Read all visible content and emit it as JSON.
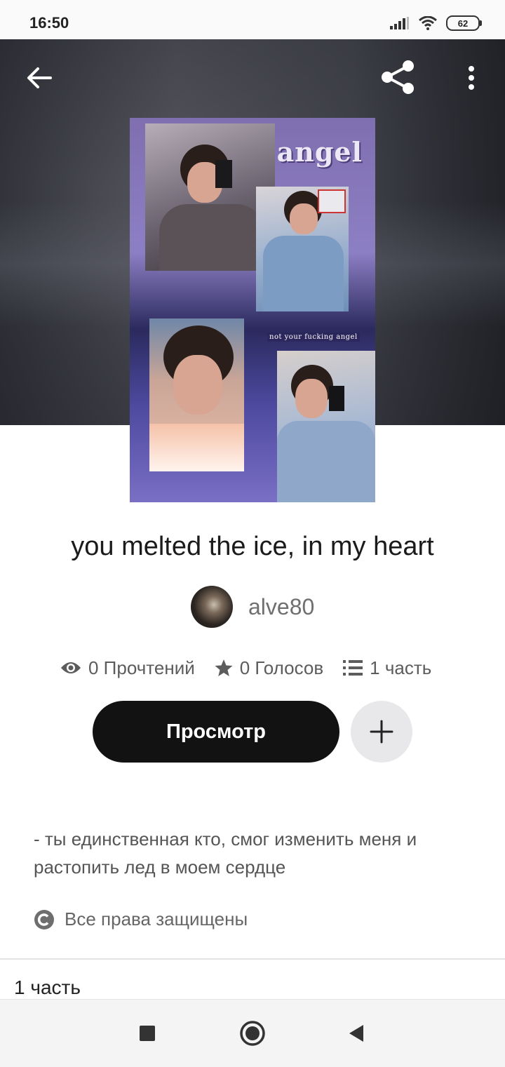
{
  "status_bar": {
    "time": "16:50",
    "battery": "62"
  },
  "header": {
    "back_icon": "arrow-left-icon",
    "share_icon": "share-icon",
    "more_icon": "more-vertical-icon"
  },
  "cover": {
    "cover_text": "angel",
    "cover_caption": "not your fucking angel"
  },
  "story": {
    "title": "you melted the ice, in my heart",
    "author": "alve80",
    "reads": "0 Прочтений",
    "votes": "0 Голосов",
    "parts": "1 часть",
    "read_button": "Просмотр",
    "description": "- ты единственная кто, смог изменить меня и растопить лед в моем сердце",
    "rights": "Все права защищены"
  },
  "toc": {
    "first_part": "1 часть"
  },
  "colors": {
    "primary_button": "#121212",
    "secondary_button": "#e8e8ea",
    "text_muted": "#5c5c5c"
  }
}
